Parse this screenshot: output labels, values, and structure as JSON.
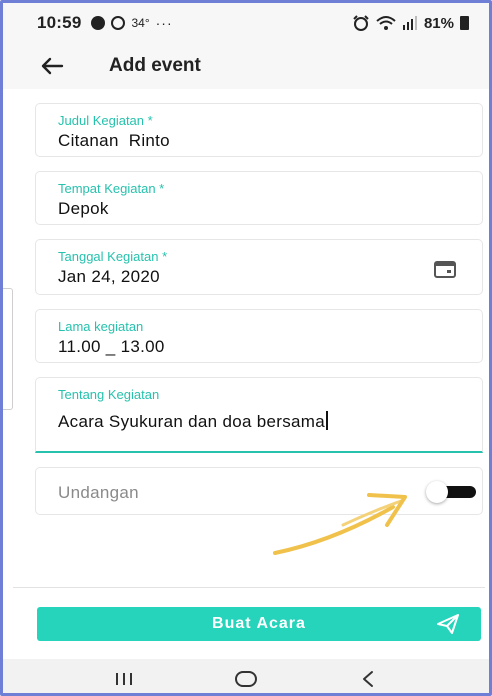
{
  "status_bar": {
    "time": "10:59",
    "temperature": "34°",
    "more": "···",
    "battery": "81%"
  },
  "app_bar": {
    "title": "Add event"
  },
  "form": {
    "judul": {
      "label": "Judul Kegiatan *",
      "value": "Citanan  Rinto"
    },
    "tempat": {
      "label": "Tempat Kegiatan *",
      "value": "Depok"
    },
    "tanggal": {
      "label": "Tanggal Kegiatan *",
      "value": "Jan 24, 2020"
    },
    "lama": {
      "label": "Lama kegiatan",
      "value": "11.00 _ 13.00"
    },
    "tentang": {
      "label": "Tentang Kegiatan",
      "value": "Acara Syukuran dan doa bersama"
    },
    "undangan": {
      "label": "Undangan",
      "toggle_on": false
    }
  },
  "submit": {
    "label": "Buat Acara"
  },
  "colors": {
    "accent": "#26c2ad",
    "button": "#26d3bb",
    "annotation_arrow": "#f0c24b"
  },
  "icons": [
    "back-arrow-icon",
    "calendar-icon",
    "send-icon",
    "recent-apps-icon",
    "home-icon",
    "back-nav-icon"
  ]
}
